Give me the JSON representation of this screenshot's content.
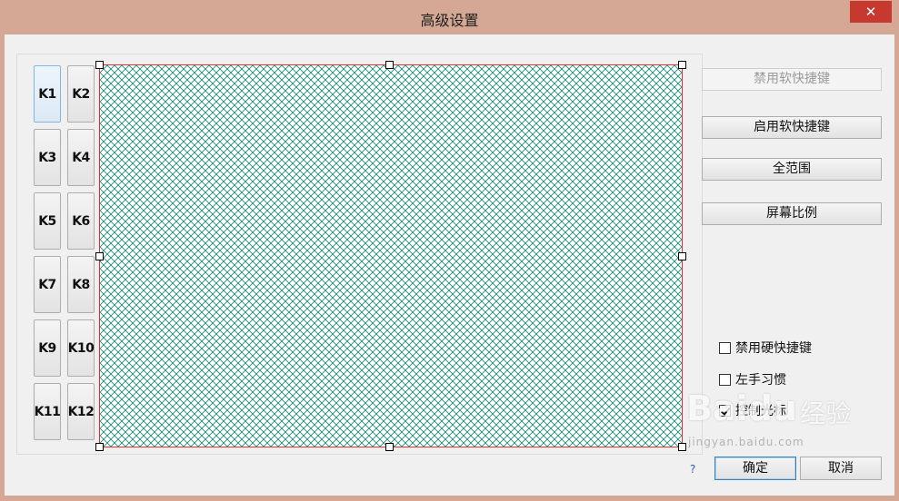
{
  "window": {
    "title": "高级设置",
    "close_label": "✕"
  },
  "keys": [
    "K1",
    "K2",
    "K3",
    "K4",
    "K5",
    "K6",
    "K7",
    "K8",
    "K9",
    "K10",
    "K11",
    "K12"
  ],
  "side_buttons": {
    "disable_soft": "禁用软快捷键",
    "enable_soft": "启用软快捷键",
    "full_range": "全范围",
    "screen_ratio": "屏幕比例"
  },
  "options": [
    {
      "label": "禁用硬快捷键",
      "checked": false
    },
    {
      "label": "左手习惯",
      "checked": false
    },
    {
      "label": "控制光标",
      "checked": true
    }
  ],
  "footer": {
    "help": "?",
    "ok": "确定",
    "cancel": "取消"
  },
  "watermark": {
    "logo": "Baidu",
    "sub": "经验",
    "url": "jingyan.baidu.com"
  },
  "colors": {
    "titlebar": "#d4a894",
    "grid": "#1a8a7a",
    "selection_border": "#e03030",
    "close": "#c7392e"
  }
}
